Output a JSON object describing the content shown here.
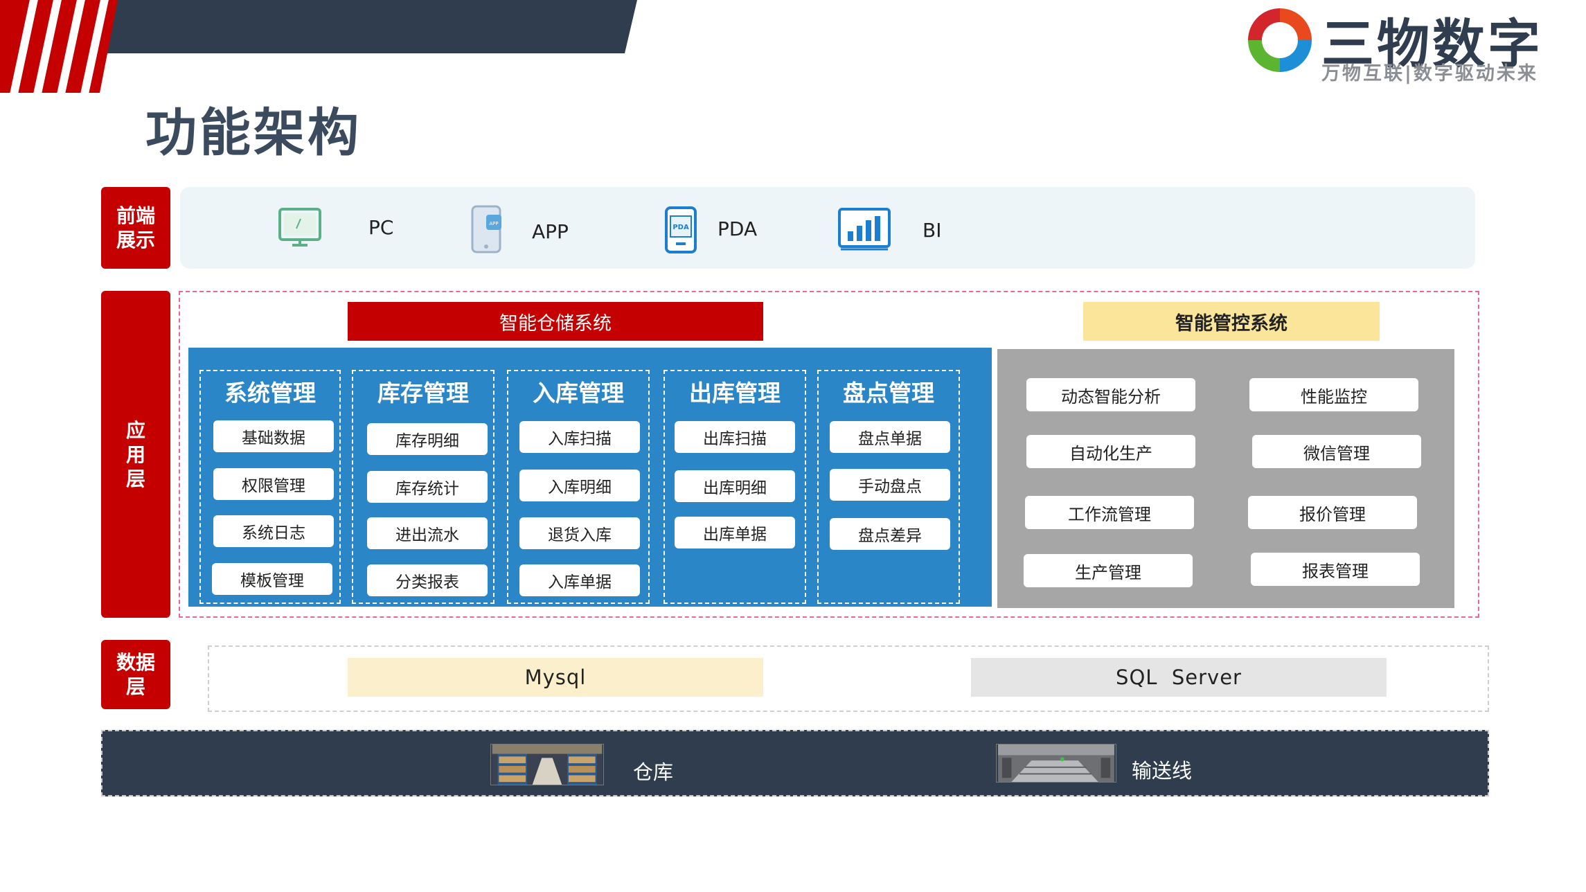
{
  "header": {
    "title": "功能架构",
    "logo_name": "三物数字",
    "logo_slogan": "万物互联|数字驱动未来",
    "accent_color": "#c40000",
    "dark_color": "#2f3d4e"
  },
  "layers": {
    "front": "前端展示",
    "app": "应用层",
    "data": "数据层"
  },
  "front_end": [
    {
      "icon": "monitor-icon",
      "label": "PC"
    },
    {
      "icon": "phone-app-icon",
      "label": "APP"
    },
    {
      "icon": "pda-device-icon",
      "label": "PDA"
    },
    {
      "icon": "bar-chart-icon",
      "label": "BI"
    }
  ],
  "warehouse_system": {
    "title": "智能仓储系统",
    "modules": [
      {
        "title": "系统管理",
        "items": [
          "基础数据",
          "权限管理",
          "系统日志",
          "模板管理"
        ]
      },
      {
        "title": "库存管理",
        "items": [
          "库存明细",
          "库存统计",
          "进出流水",
          "分类报表"
        ]
      },
      {
        "title": "入库管理",
        "items": [
          "入库扫描",
          "入库明细",
          "退货入库",
          "入库单据"
        ]
      },
      {
        "title": "出库管理",
        "items": [
          "出库扫描",
          "出库明细",
          "出库单据"
        ]
      },
      {
        "title": "盘点管理",
        "items": [
          "盘点单据",
          "手动盘点",
          "盘点差异"
        ]
      }
    ]
  },
  "control_system": {
    "title": "智能管控系统",
    "items": [
      "动态智能分析",
      "性能监控",
      "自动化生产",
      "微信管理",
      "工作流管理",
      "报价管理",
      "生产管理",
      "报表管理"
    ]
  },
  "databases": [
    "Mysql",
    "SQL  Server"
  ],
  "infrastructure": [
    {
      "icon": "warehouse-photo",
      "label": "仓库"
    },
    {
      "icon": "conveyor-photo",
      "label": "输送线"
    }
  ]
}
